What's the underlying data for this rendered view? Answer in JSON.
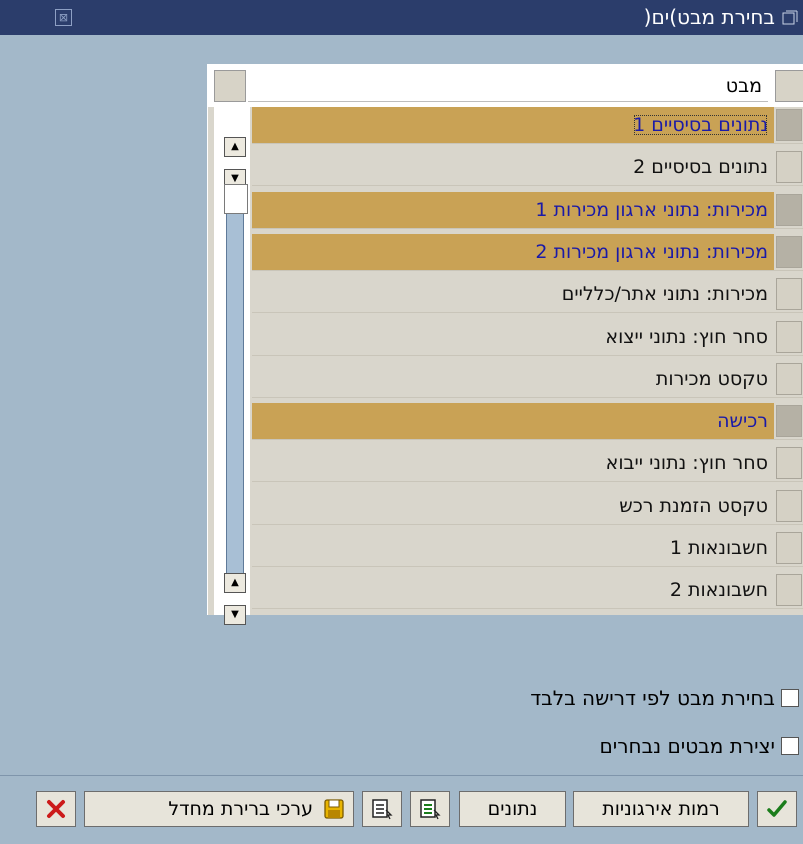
{
  "window": {
    "title": "בחירת מבט)ים(",
    "close_glyph": "⊠"
  },
  "table": {
    "column_header": "מבט",
    "rows": [
      {
        "label": "נתונים בסיסיים 1",
        "selected": true
      },
      {
        "label": "נתונים בסיסיים 2",
        "selected": false
      },
      {
        "label": "מכירות: נתוני ארגון מכירות 1",
        "selected": true
      },
      {
        "label": "מכירות: נתוני ארגון מכירות 2",
        "selected": true
      },
      {
        "label": "מכירות: נתוני אתר/כלליים",
        "selected": false
      },
      {
        "label": "סחר חוץ: נתוני ייצוא",
        "selected": false
      },
      {
        "label": "טקסט מכירות",
        "selected": false
      },
      {
        "label": "רכישה",
        "selected": true
      },
      {
        "label": "סחר חוץ: נתוני ייבוא",
        "selected": false
      },
      {
        "label": "טקסט הזמנת רכש",
        "selected": false
      },
      {
        "label": "חשבונאות 1",
        "selected": false
      },
      {
        "label": "חשבונאות 2",
        "selected": false
      }
    ]
  },
  "options": {
    "only_on_request": "בחירת מבט לפי דרישה בלבד",
    "create_selected": "יצירת מבטים נבחרים"
  },
  "toolbar": {
    "continue_icon": "checkmark-icon",
    "org_levels_label": "רמות אירגוניות",
    "data_label": "נתונים",
    "select_all_icon": "select-all-icon",
    "deselect_all_icon": "deselect-all-icon",
    "save_icon": "save-icon",
    "default_values_label": "ערכי ברירת מחדל",
    "cancel_icon": "cancel-icon"
  },
  "colors": {
    "background": "#a3b8c9",
    "titlebar": "#2b3d6b",
    "selected_row": "#c9a255",
    "selected_text": "#1a1aa8",
    "normal_row": "#d9d6cc"
  }
}
